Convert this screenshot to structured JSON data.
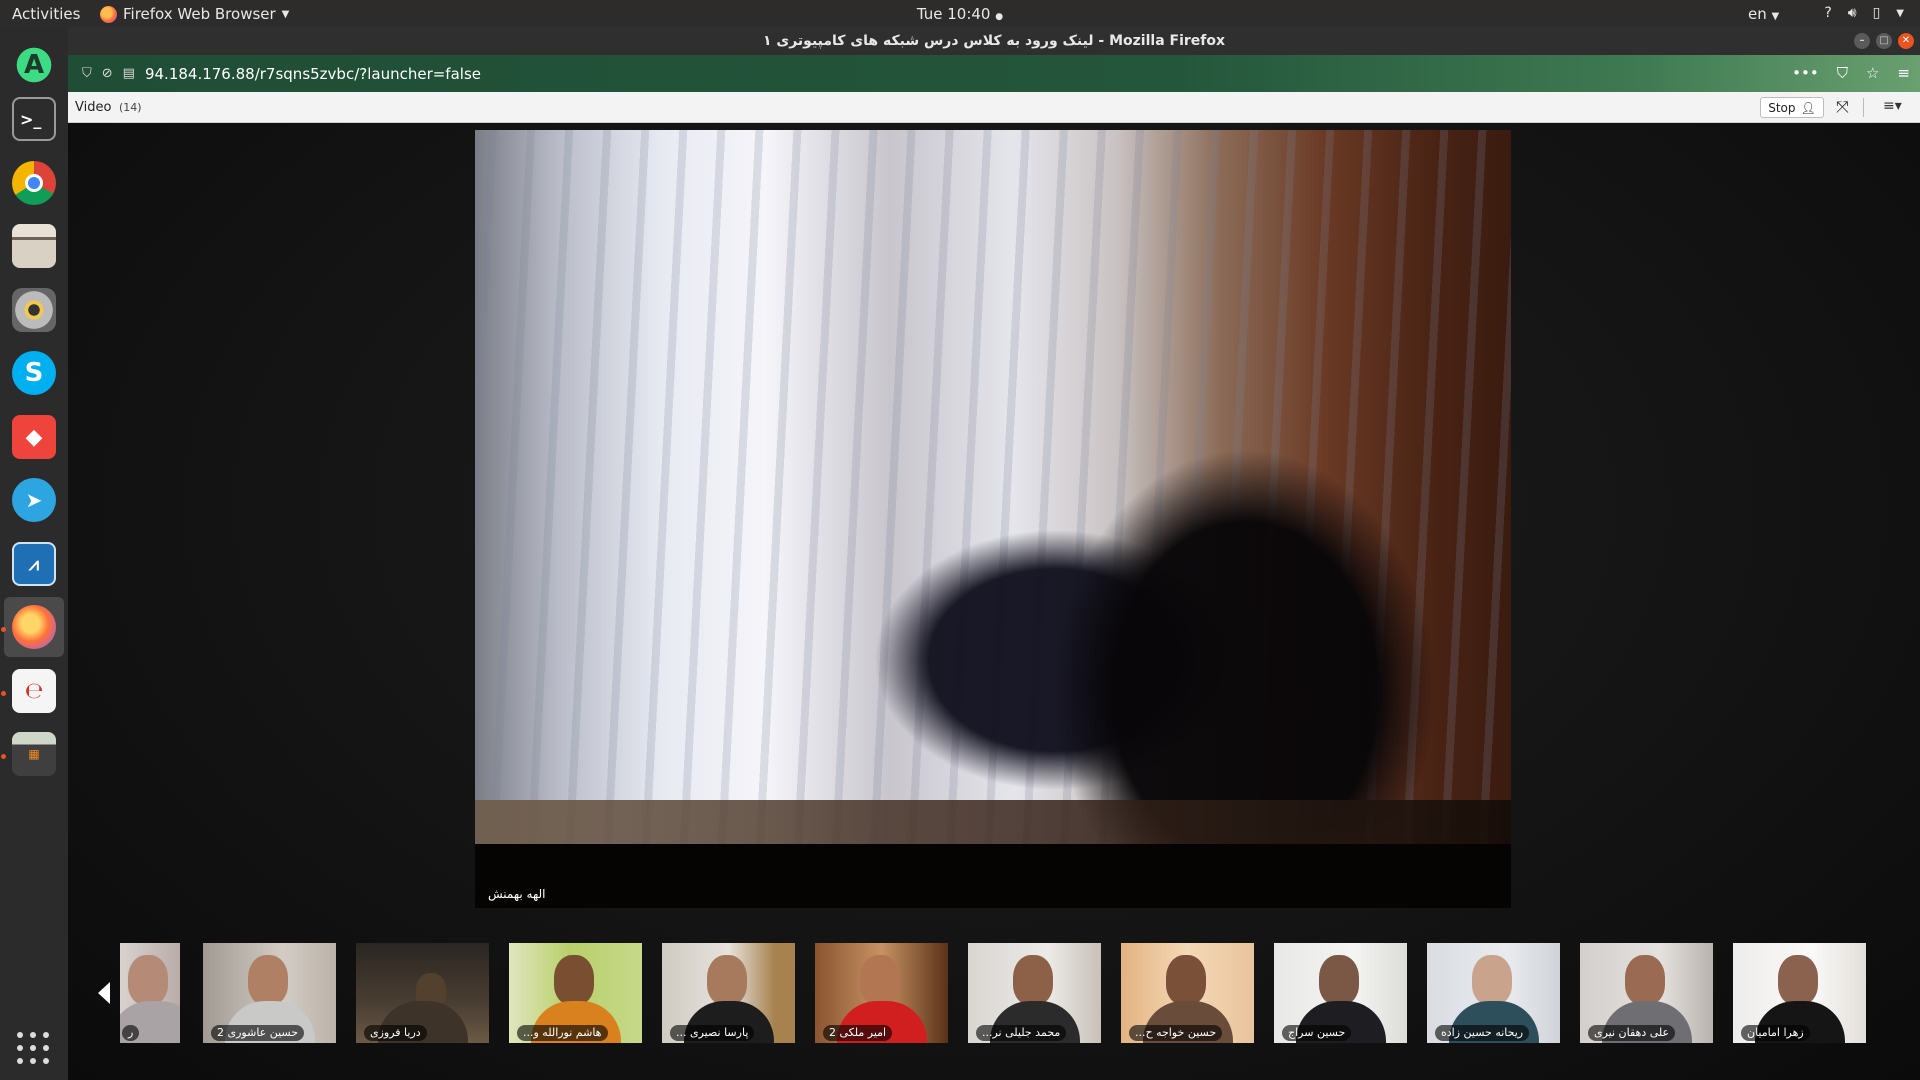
{
  "topbar": {
    "activities": "Activities",
    "app_name": "Firefox Web Browser",
    "clock": "Tue 10:40",
    "lang": "en",
    "tray_icons": [
      "help-icon",
      "volume-icon",
      "battery-icon",
      "system-menu-icon"
    ]
  },
  "dock": {
    "items": [
      "android-studio",
      "terminal",
      "chrome",
      "files",
      "rhythmbox",
      "skype",
      "anydesk",
      "telegram",
      "system-monitor",
      "firefox",
      "document-viewer",
      "calculator"
    ]
  },
  "window": {
    "title": "لینک ورود به کلاس درس شبکه های کامپیوتری ۱ - Mozilla Firefox",
    "url": "94.184.176.88/r7sqns5zvbc/?launcher=false"
  },
  "pod": {
    "title": "Video",
    "count": "(14)",
    "stop_label": "Stop"
  },
  "main_video": {
    "name": "الهه بهمنش"
  },
  "thumbnails": [
    {
      "name": "ر"
    },
    {
      "name": "حسین عاشوری 2"
    },
    {
      "name": "دریا فروزی"
    },
    {
      "name": "هاشم نورالله و..."
    },
    {
      "name": "پارسا نصیری ..."
    },
    {
      "name": "امیر ملکی 2"
    },
    {
      "name": "محمد جلیلی نر..."
    },
    {
      "name": "حسین خواجه ح..."
    },
    {
      "name": "حسین سراج"
    },
    {
      "name": "ریحانه حسین زاده"
    },
    {
      "name": "علی دهقان نیری"
    },
    {
      "name": "زهرا امامیان"
    }
  ]
}
